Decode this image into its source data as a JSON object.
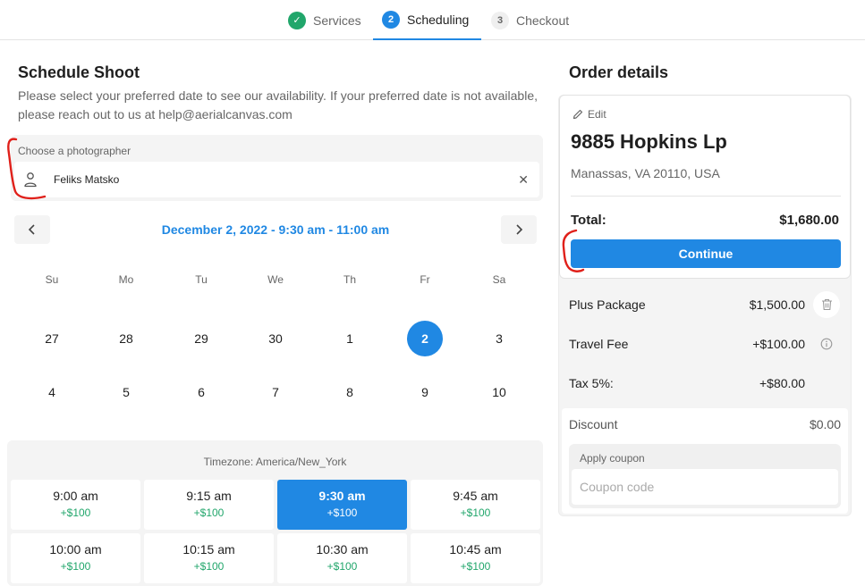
{
  "stepper": {
    "steps": [
      {
        "badge": "✓",
        "label": "Services",
        "state": "done"
      },
      {
        "badge": "2",
        "label": "Scheduling",
        "state": "active"
      },
      {
        "badge": "3",
        "label": "Checkout",
        "state": "upcoming"
      }
    ]
  },
  "schedule": {
    "title": "Schedule Shoot",
    "description": "Please select your preferred date to see our availability. If your preferred date is not available, please reach out to us at help@aerialcanvas.com",
    "photographer": {
      "label": "Choose a photographer",
      "value": "Feliks Matsko",
      "icon": "person-icon",
      "clear_icon": "✕"
    },
    "calendar": {
      "selected_label": "December 2, 2022 - 9:30 am - 11:00 am",
      "prev_icon": "chevron-left-icon",
      "next_icon": "chevron-right-icon",
      "weekdays": [
        "Su",
        "Mo",
        "Tu",
        "We",
        "Th",
        "Fr",
        "Sa"
      ],
      "weeks": [
        [
          "27",
          "28",
          "29",
          "30",
          "1",
          "2",
          "3"
        ],
        [
          "4",
          "5",
          "6",
          "7",
          "8",
          "9",
          "10"
        ]
      ],
      "selected_day": "2"
    },
    "timeslots": {
      "timezone_label": "Timezone: America/New_York",
      "slots": [
        {
          "time": "9:00 am",
          "price": "+$100"
        },
        {
          "time": "9:15 am",
          "price": "+$100"
        },
        {
          "time": "9:30 am",
          "price": "+$100"
        },
        {
          "time": "9:45 am",
          "price": "+$100"
        },
        {
          "time": "10:00 am",
          "price": "+$100"
        },
        {
          "time": "10:15 am",
          "price": "+$100"
        },
        {
          "time": "10:30 am",
          "price": "+$100"
        },
        {
          "time": "10:45 am",
          "price": "+$100"
        }
      ],
      "selected_index": 2
    }
  },
  "order": {
    "title": "Order details",
    "edit_label": "Edit",
    "address": "9885 Hopkins Lp",
    "city": "Manassas, VA 20110, USA",
    "total_label": "Total:",
    "total_value": "$1,680.00",
    "continue_label": "Continue",
    "lines": [
      {
        "label": "Plus Package",
        "value": "$1,500.00",
        "icon": "trash-icon"
      },
      {
        "label": "Travel Fee",
        "value": "+$100.00",
        "icon": "info-icon"
      },
      {
        "label": "Tax 5%:",
        "value": "+$80.00",
        "icon": ""
      }
    ],
    "discount_label": "Discount",
    "discount_value": "$0.00",
    "coupon_label": "Apply coupon",
    "coupon_placeholder": "Coupon code",
    "coupon_value": ""
  },
  "colors": {
    "accent": "#2088e3",
    "success": "#21a66b",
    "annotation": "#e0201a"
  }
}
